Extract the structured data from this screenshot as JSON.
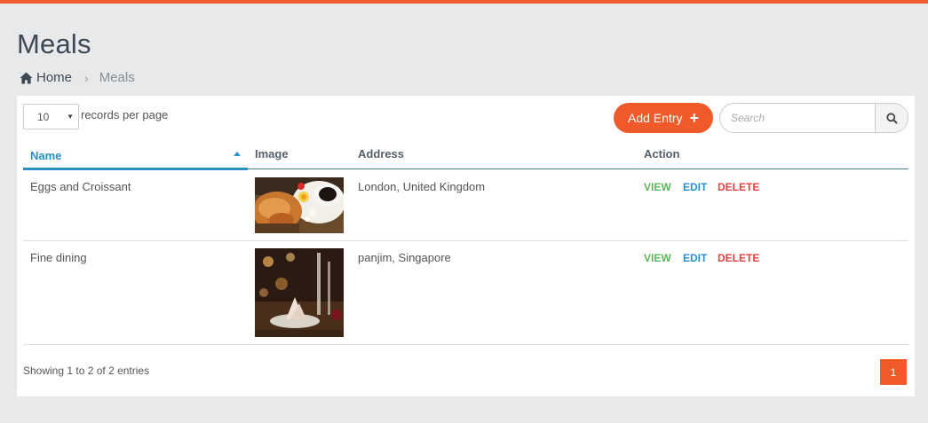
{
  "page": {
    "title": "Meals"
  },
  "breadcrumb": {
    "home_label": "Home",
    "current_label": "Meals",
    "separator": "›"
  },
  "toolbar": {
    "page_length_value": "10",
    "page_length_label": "records per page",
    "add_button_label": "Add Entry",
    "add_button_icon": "+",
    "search_placeholder": "Search"
  },
  "table": {
    "columns": [
      "Name",
      "Image",
      "Address",
      "Action"
    ],
    "sort_column": "Name",
    "sort_direction": "ascending",
    "rows": [
      {
        "name": "Eggs and Croissant",
        "image": "breakfast-photo",
        "address": "London, United Kingdom",
        "actions": {
          "view": "VIEW",
          "edit": "EDIT",
          "delete": "DELETE"
        }
      },
      {
        "name": "Fine dining",
        "image": "dining-table-photo",
        "address": "panjim, Singapore",
        "actions": {
          "view": "VIEW",
          "edit": "EDIT",
          "delete": "DELETE"
        }
      }
    ]
  },
  "footer": {
    "info": "Showing 1 to 2 of 2 entries",
    "current_page": "1"
  },
  "colors": {
    "accent": "#f0592a",
    "link": "#2a8fc7",
    "view": "#5cb85c",
    "delete": "#e3433e",
    "background": "#e7e9eb"
  }
}
